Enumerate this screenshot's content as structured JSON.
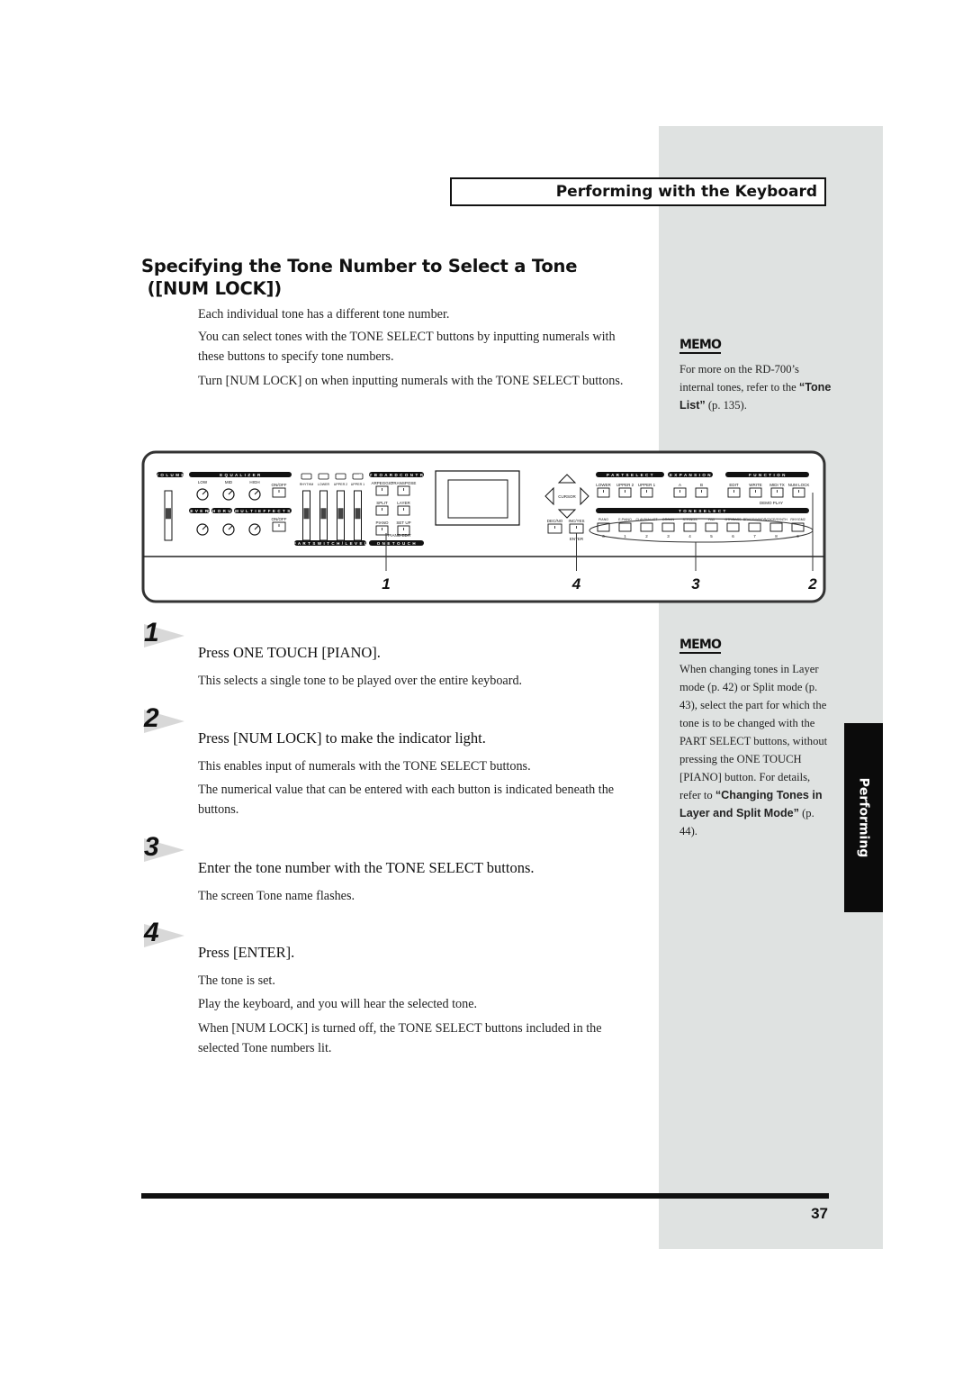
{
  "header": {
    "section_title": "Performing with the Keyboard"
  },
  "title": {
    "line1": "Specifying the Tone Number to Select a Tone",
    "line2": "([NUM LOCK])"
  },
  "intro": [
    "Each individual tone has a different tone number.",
    "You can select tones with the TONE SELECT buttons by inputting numerals with these buttons to specify tone numbers.",
    "Turn [NUM LOCK] on when inputting numerals with the TONE SELECT buttons."
  ],
  "memo1": {
    "label": "MEMO",
    "text_before": "For more on the RD-700’s internal tones, refer to the ",
    "link": "“Tone List”",
    "text_after": " (p. 135)."
  },
  "panel": {
    "volume": "VOLUME",
    "equalizer": "EQUALIZER",
    "eq_knobs": [
      "LOW",
      "MID",
      "HIGH"
    ],
    "on_off": "ON/OFF",
    "effects": [
      "REVERB",
      "CHORUS",
      "MULTI EFFECTS"
    ],
    "part_switches": [
      "RHYTHM",
      "LOWER",
      "UPPER 2",
      "UPPER 1"
    ],
    "part_switch_level": "PART SWITCH/LEVEL",
    "keyboard_control": "KEYBOARD CONTROL",
    "kc_buttons": [
      "ARPEGGIO",
      "TRANSPOSE",
      "SPLIT",
      "LAYER",
      "PIANO",
      "SET UP"
    ],
    "piano_edit": "PIANO EDIT",
    "one_touch": "ONE TOUCH",
    "cursor": "CURSOR",
    "dec_no": "DEC/NO",
    "inc_yes": "INC/YES",
    "enter": "ENTER",
    "part_select": "PART SELECT",
    "part_select_buttons": [
      "LOWER",
      "UPPER 2",
      "UPPER 1"
    ],
    "expansion": "EXPANSION",
    "expansion_buttons": [
      "A",
      "B"
    ],
    "function": "FUNCTION",
    "function_buttons": [
      "EDIT",
      "WRITE",
      "MIDI TX",
      "NUM LOCK"
    ],
    "demo_play": "DEMO PLAY",
    "tone_select": "TONE SELECT",
    "tone_buttons": [
      "PIANO",
      "E.PIANO",
      "CLAV/MALLET",
      "ORGAN",
      "STRINGS",
      "PAD",
      "GTR/BASS",
      "BRASS/WINDS",
      "VOICE/SYNTH",
      "RHY/GM2"
    ],
    "tone_numbers": [
      "0",
      "1",
      "2",
      "3",
      "4",
      "5",
      "6",
      "7",
      "8",
      "9"
    ],
    "callouts": [
      "1",
      "4",
      "3",
      "2"
    ]
  },
  "steps": [
    {
      "num": "1",
      "heading": "Press ONE TOUCH [PIANO].",
      "body": [
        "This selects a single tone to be played over the entire keyboard."
      ]
    },
    {
      "num": "2",
      "heading": "Press [NUM LOCK] to make the indicator light.",
      "body": [
        "This enables input of numerals with the TONE SELECT buttons.",
        "The numerical value that can be entered with each button is indicated beneath the buttons."
      ]
    },
    {
      "num": "3",
      "heading": "Enter the tone number with the TONE SELECT buttons.",
      "body": [
        "The screen Tone name flashes."
      ]
    },
    {
      "num": "4",
      "heading": "Press [ENTER].",
      "body": [
        "The tone is set.",
        "Play the keyboard, and you will hear the selected tone.",
        "When [NUM LOCK] is turned off, the TONE SELECT buttons included in the selected Tone numbers lit."
      ]
    }
  ],
  "memo2": {
    "label": "MEMO",
    "text_before": "When changing tones in Layer mode (p. 42) or Split mode (p. 43), select the part for which the tone is to be changed with the PART SELECT buttons, without pressing the ONE TOUCH [PIANO] button. For details, refer to ",
    "link": "“Changing Tones in Layer and Split Mode”",
    "text_after": " (p. 44)."
  },
  "side_tab": {
    "label": "Performing"
  },
  "footer": {
    "page_number": "37"
  }
}
